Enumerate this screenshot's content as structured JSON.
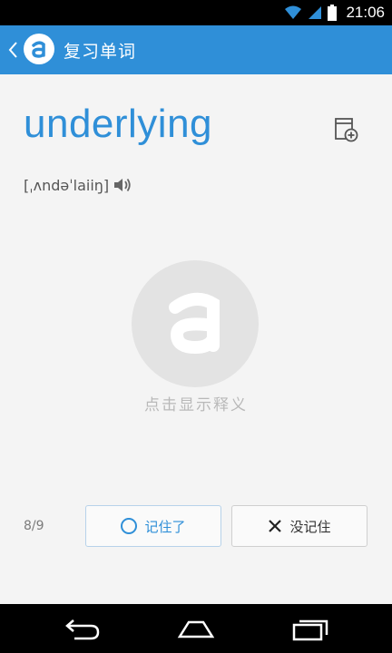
{
  "status_bar": {
    "time": "21:06"
  },
  "app_bar": {
    "title": "复习单词"
  },
  "card": {
    "word": "underlying",
    "phonetic": "[ˌʌndəˈlaiiŋ]",
    "reveal_hint": "点击显示释义"
  },
  "actions": {
    "progress": "8/9",
    "remembered_label": "记住了",
    "forgot_label": "没记住"
  },
  "colors": {
    "accent": "#2f8fd8",
    "background": "#f4f4f4",
    "nav_background": "#000000"
  },
  "icons": {
    "back": "chevron-left-icon",
    "logo": "letter-a-logo",
    "add_to_notebook": "notebook-add-icon",
    "speaker": "speaker-icon",
    "remembered": "ring-icon",
    "forgot": "close-icon"
  }
}
